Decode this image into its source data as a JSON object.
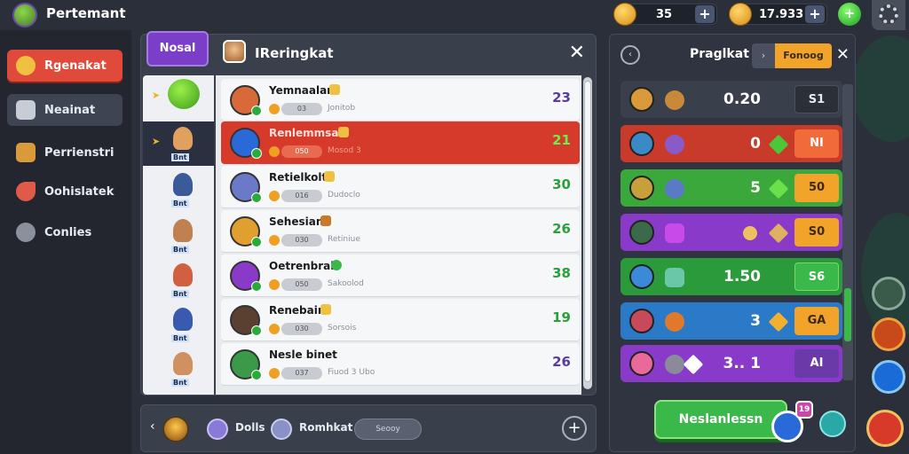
{
  "app": {
    "title": "Pertemant"
  },
  "resources": [
    {
      "value": "35",
      "plus": "+"
    },
    {
      "value": "17.933",
      "plus": "+"
    }
  ],
  "sidebar": {
    "items": [
      {
        "label": "Rgenakat",
        "icon": "map-icon",
        "state": "active"
      },
      {
        "label": "Neainat",
        "icon": "mail-icon",
        "state": "selected"
      },
      {
        "label": "Perrienstri",
        "icon": "chest-icon",
        "state": "normal"
      },
      {
        "label": "Oohislatek",
        "icon": "horn-icon",
        "state": "normal"
      },
      {
        "label": "Conlies",
        "icon": "gear-icon",
        "state": "normal"
      }
    ]
  },
  "main_panel": {
    "tab": "Nosal",
    "title": "IReringkat",
    "close": "✕",
    "left_column": [
      {
        "label": "",
        "badge": "green-orb"
      },
      {
        "label": "Bnt"
      },
      {
        "label": "Bnt"
      },
      {
        "label": "Bnt"
      },
      {
        "label": "Bnt"
      },
      {
        "label": "Bnt"
      },
      {
        "label": "Bnt"
      }
    ],
    "rows": [
      {
        "name": "Yemnaalan",
        "pill": "03",
        "sub": "Jonitob",
        "score": "23",
        "score_color": "#5a3aa0"
      },
      {
        "name": "Renlemmsar",
        "pill": "050",
        "sub": "Mosod 3",
        "score": "21",
        "score_color": "#6af04a",
        "highlight": true
      },
      {
        "name": "Retielkolt",
        "pill": "016",
        "sub": "Dudoclo",
        "score": "30",
        "score_color": "#2aa03a"
      },
      {
        "name": "Sehesian",
        "pill": "030",
        "sub": "Retiniue",
        "score": "26",
        "score_color": "#2aa03a"
      },
      {
        "name": "Oetrenbrab",
        "pill": "050",
        "sub": "Sakoolod",
        "score": "38",
        "score_color": "#2aa03a"
      },
      {
        "name": "Renebain",
        "pill": "030",
        "sub": "Sorsois",
        "score": "19",
        "score_color": "#2aa03a"
      },
      {
        "name": "Nesle binet",
        "pill": "037",
        "sub": "Fiuod 3 Ubo",
        "score": "26",
        "score_color": "#5a3aa0"
      }
    ]
  },
  "bottom_bar": {
    "back": "‹",
    "items": [
      {
        "label": "Dolls"
      },
      {
        "label": "Romhkat"
      }
    ],
    "pill": "Seooy",
    "plus": "+"
  },
  "right_panel": {
    "back": "‹",
    "title": "Praglkat",
    "tab_icon": "›",
    "tab": "Fonoog",
    "close": "✕",
    "rows": [
      {
        "value": "0.20",
        "button": "S1",
        "color": "#3a3f4c",
        "btn_bg": "#2a2f38",
        "btn_fg": "#e6ebf2",
        "chev": "none"
      },
      {
        "value": "0",
        "button": "NI",
        "color": "#c83a2a",
        "btn_bg": "#f06a3a",
        "btn_fg": "#fff",
        "chev": "#4ac83a"
      },
      {
        "value": "5",
        "button": "50",
        "color": "#3aa83a",
        "btn_bg": "#f2a42a",
        "btn_fg": "#3a2a10",
        "chev": "#6ae04a"
      },
      {
        "value": "",
        "button": "S0",
        "color": "#8a3ac8",
        "btn_bg": "#f2a42a",
        "btn_fg": "#3a2a10",
        "chev": "#f0c060"
      },
      {
        "value": "1.50",
        "button": "S6",
        "color": "#2a9a3a",
        "btn_bg": "#3ab84a",
        "btn_fg": "#fff",
        "chev": "none"
      },
      {
        "value": "3",
        "button": "GA",
        "color": "#2a7ac8",
        "btn_bg": "#f2a42a",
        "btn_fg": "#3a2a10",
        "chev": "#f0b030"
      },
      {
        "value": "3.. 1",
        "button": "AI",
        "color": "#8a3ac8",
        "btn_bg": "#6a3aa8",
        "btn_fg": "#fff",
        "chev": "#fff"
      }
    ],
    "main_button": "Neslanlessn",
    "bubble_count": "19"
  }
}
